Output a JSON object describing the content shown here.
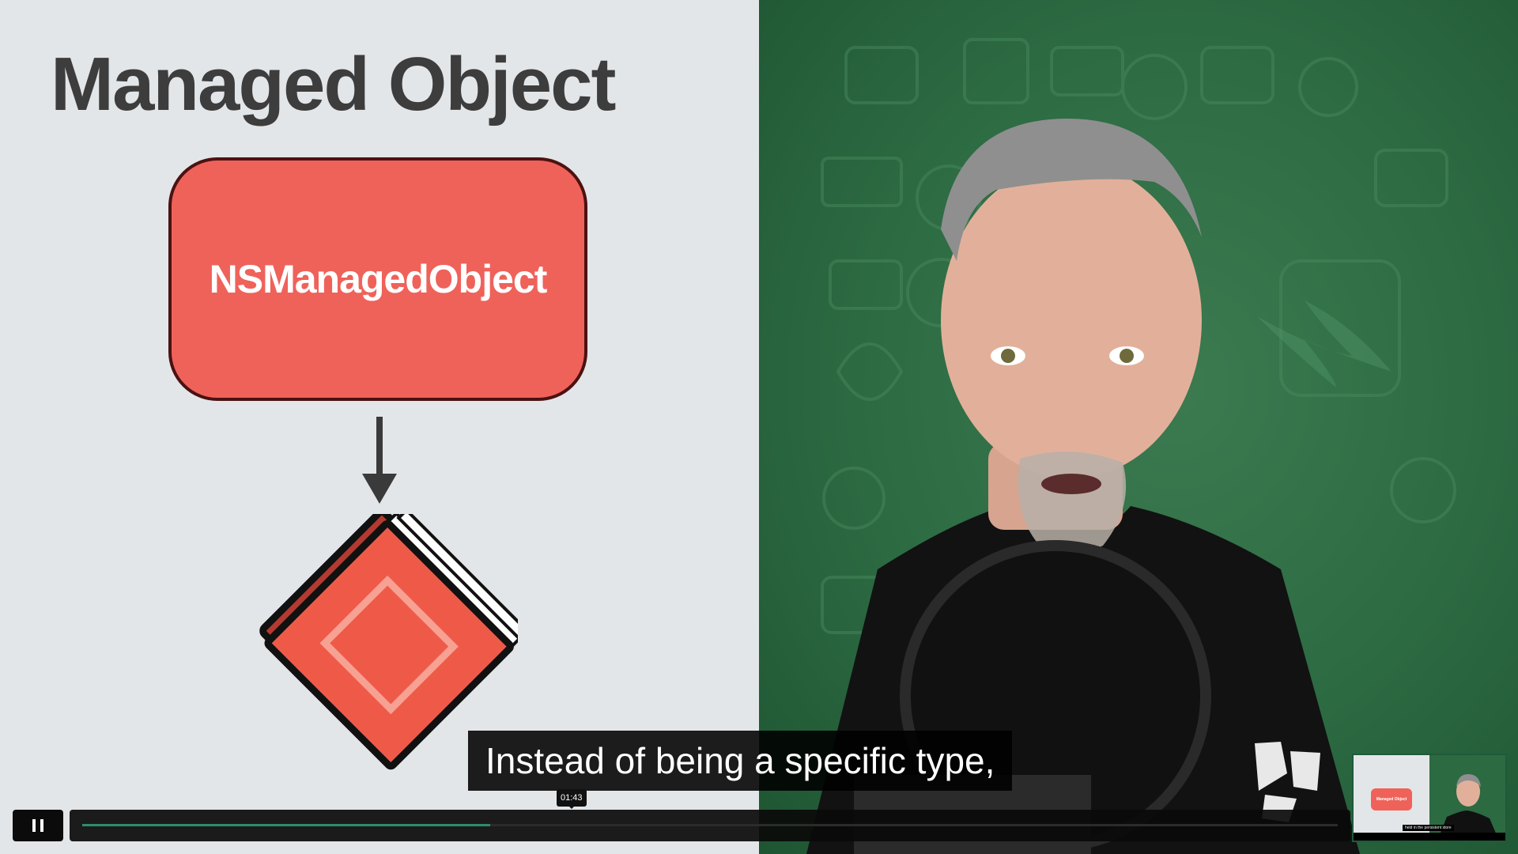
{
  "slide": {
    "title": "Managed Object",
    "entity_label": "NSManagedObject"
  },
  "caption": {
    "text": "Instead of being a specific type,"
  },
  "player": {
    "progress_fraction": 0.325,
    "time_tooltip": "01:43",
    "pause_icon": "pause-icon"
  },
  "minimap": {
    "slide_label": "Managed Object",
    "caption_text": "held in the persistent store"
  },
  "colors": {
    "slide_bg": "#e3e6e8",
    "entity_box": "#ef625a",
    "backdrop_green": "#2c6a42",
    "progress_fill": "#2f8c6a"
  }
}
